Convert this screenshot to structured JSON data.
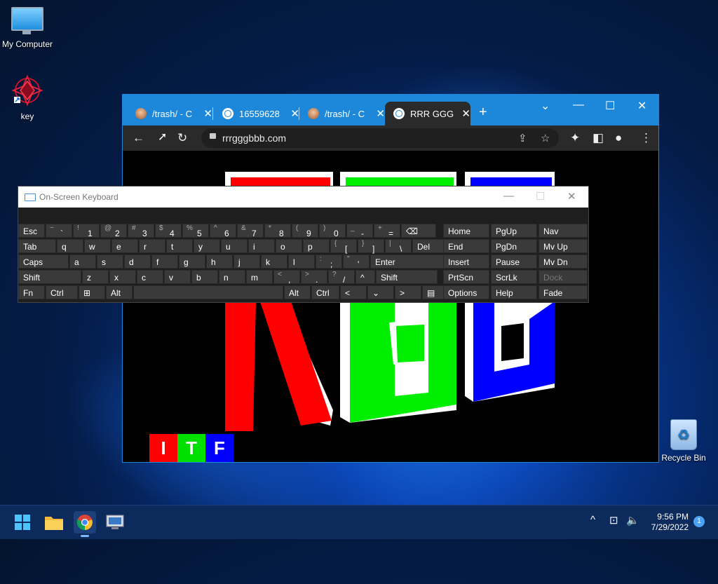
{
  "desktop": {
    "icons": [
      {
        "label": "My Computer",
        "icon": "monitor-icon"
      },
      {
        "label": "key",
        "icon": "key-app-icon"
      },
      {
        "label": "Recycle Bin",
        "icon": "recycle-bin-icon"
      }
    ]
  },
  "browser": {
    "tabs": [
      {
        "title": "/trash/ - C",
        "icon": "trash-site-icon",
        "close": "✕"
      },
      {
        "title": "16559628",
        "icon": "globe-icon",
        "close": "✕"
      },
      {
        "title": "/trash/ - C",
        "icon": "trash-site-icon",
        "close": "✕"
      },
      {
        "title": "RRR GGG",
        "icon": "globe-icon",
        "close": "✕",
        "active": true
      }
    ],
    "new_tab": "+",
    "window_controls": {
      "list": "⌄",
      "minimize": "—",
      "maximize": "☐",
      "close": "✕"
    },
    "toolbar": {
      "back": "←",
      "reload": "↻",
      "url": "rrrgggbbb.com",
      "share": "⇪",
      "star": "☆",
      "extensions": "✦",
      "sidebar": "◧",
      "profile": "●",
      "menu": "⋮"
    },
    "page": {
      "banner_letters": [
        "R",
        "G",
        "B"
      ],
      "badge": [
        {
          "letter": "I",
          "color": "#ff0000"
        },
        {
          "letter": "T",
          "color": "#00e000"
        },
        {
          "letter": "F",
          "color": "#0000ff"
        }
      ]
    }
  },
  "osk": {
    "title": "On-Screen Keyboard",
    "controls": {
      "minimize": "—",
      "maximize": "☐",
      "close": "✕"
    },
    "rows": [
      [
        {
          "m": "Esc"
        },
        {
          "s": "~",
          "n": "`"
        },
        {
          "s": "!",
          "n": "1"
        },
        {
          "s": "@",
          "n": "2"
        },
        {
          "s": "#",
          "n": "3"
        },
        {
          "s": "$",
          "n": "4"
        },
        {
          "s": "%",
          "n": "5"
        },
        {
          "s": "^",
          "n": "6"
        },
        {
          "s": "&",
          "n": "7"
        },
        {
          "s": "*",
          "n": "8"
        },
        {
          "s": "(",
          "n": "9"
        },
        {
          "s": ")",
          "n": "0"
        },
        {
          "s": "_",
          "n": "-"
        },
        {
          "s": "+",
          "n": "="
        },
        {
          "m": "⌫"
        }
      ],
      [
        {
          "m": "Tab"
        },
        {
          "m": "q"
        },
        {
          "m": "w"
        },
        {
          "m": "e"
        },
        {
          "m": "r"
        },
        {
          "m": "t"
        },
        {
          "m": "y"
        },
        {
          "m": "u"
        },
        {
          "m": "i"
        },
        {
          "m": "o"
        },
        {
          "m": "p"
        },
        {
          "s": "{",
          "n": "["
        },
        {
          "s": "}",
          "n": "]"
        },
        {
          "s": "|",
          "n": "\\"
        },
        {
          "m": "Del"
        }
      ],
      [
        {
          "m": "Caps"
        },
        {
          "m": "a"
        },
        {
          "m": "s"
        },
        {
          "m": "d"
        },
        {
          "m": "f"
        },
        {
          "m": "g"
        },
        {
          "m": "h"
        },
        {
          "m": "j"
        },
        {
          "m": "k"
        },
        {
          "m": "l"
        },
        {
          "s": ":",
          "n": ";"
        },
        {
          "s": "\"",
          "n": "'"
        },
        {
          "m": "Enter"
        }
      ],
      [
        {
          "m": "Shift"
        },
        {
          "m": "z"
        },
        {
          "m": "x"
        },
        {
          "m": "c"
        },
        {
          "m": "v"
        },
        {
          "m": "b"
        },
        {
          "m": "n"
        },
        {
          "m": "m"
        },
        {
          "s": "<",
          "n": ","
        },
        {
          "s": ">",
          "n": "."
        },
        {
          "s": "?",
          "n": "/"
        },
        {
          "m": "^"
        },
        {
          "m": "Shift"
        }
      ],
      [
        {
          "m": "Fn"
        },
        {
          "m": "Ctrl"
        },
        {
          "m": "⊞"
        },
        {
          "m": "Alt"
        },
        {
          "m": ""
        },
        {
          "m": "Alt"
        },
        {
          "m": "Ctrl"
        },
        {
          "m": "<"
        },
        {
          "m": "⌄"
        },
        {
          "m": ">"
        },
        {
          "m": "▤"
        }
      ]
    ],
    "nav": [
      [
        "Home",
        "PgUp",
        "Nav"
      ],
      [
        "End",
        "PgDn",
        "Mv Up"
      ],
      [
        "Insert",
        "Pause",
        "Mv Dn"
      ],
      [
        "PrtScn",
        "ScrLk",
        "Dock"
      ],
      [
        "Options",
        "Help",
        "Fade"
      ]
    ]
  },
  "taskbar": {
    "apps": [
      "start-icon",
      "file-explorer-icon",
      "chrome-icon",
      "remote-desktop-icon"
    ],
    "tray": {
      "chevron": "^",
      "network": "⊡",
      "volume": "🔈"
    },
    "time": "9:56 PM",
    "date": "7/29/2022",
    "notifications": "1"
  }
}
